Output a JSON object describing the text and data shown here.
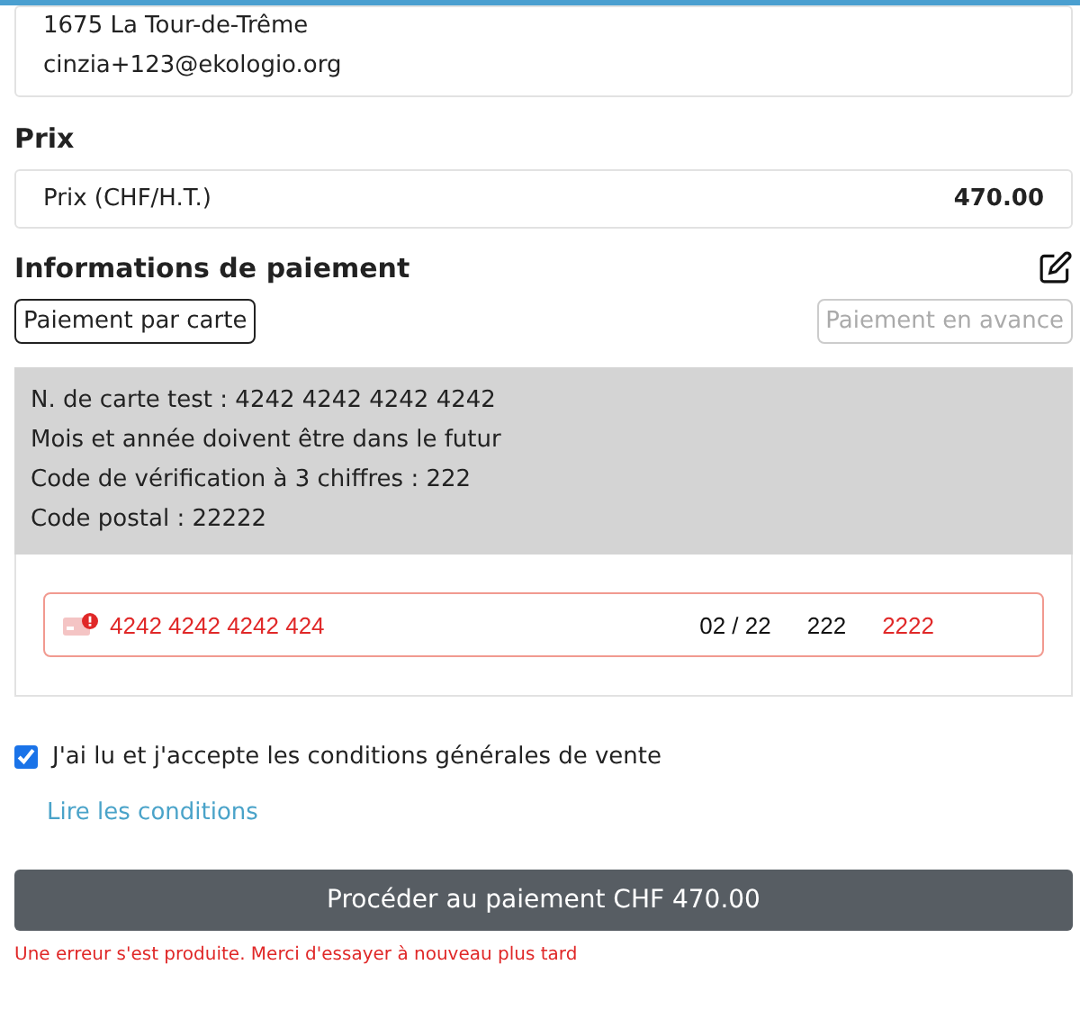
{
  "address": {
    "lines": [
      "1675 La Tour-de-Trême",
      "cinzia+123@ekologio.org"
    ]
  },
  "price": {
    "heading": "Prix",
    "label": "Prix (CHF/H.T.)",
    "value": "470.00"
  },
  "payment": {
    "heading": "Informations de paiement",
    "methods": [
      {
        "label": "Paiement par carte",
        "selected": true
      },
      {
        "label": "Paiement en avance",
        "selected": false
      }
    ],
    "test_info": [
      "N. de carte test : 4242 4242 4242 4242",
      "Mois et année doivent être dans le futur",
      "Code de vérification à 3 chiffres : 222",
      "Code postal : 22222"
    ],
    "card": {
      "number": {
        "value": "4242 4242 4242 424",
        "invalid": true
      },
      "expiry": {
        "value": "02 / 22",
        "invalid": false
      },
      "cvc": {
        "value": "222",
        "invalid": false
      },
      "postal": {
        "value": "2222",
        "invalid": true
      }
    }
  },
  "terms": {
    "label": "J'ai lu et j'accepte les conditions générales de vente",
    "checked": true,
    "link": "Lire les conditions"
  },
  "submit": {
    "label": "Procéder au paiement CHF 470.00"
  },
  "error": "Une erreur s'est produite. Merci d'essayer à nouveau plus tard"
}
